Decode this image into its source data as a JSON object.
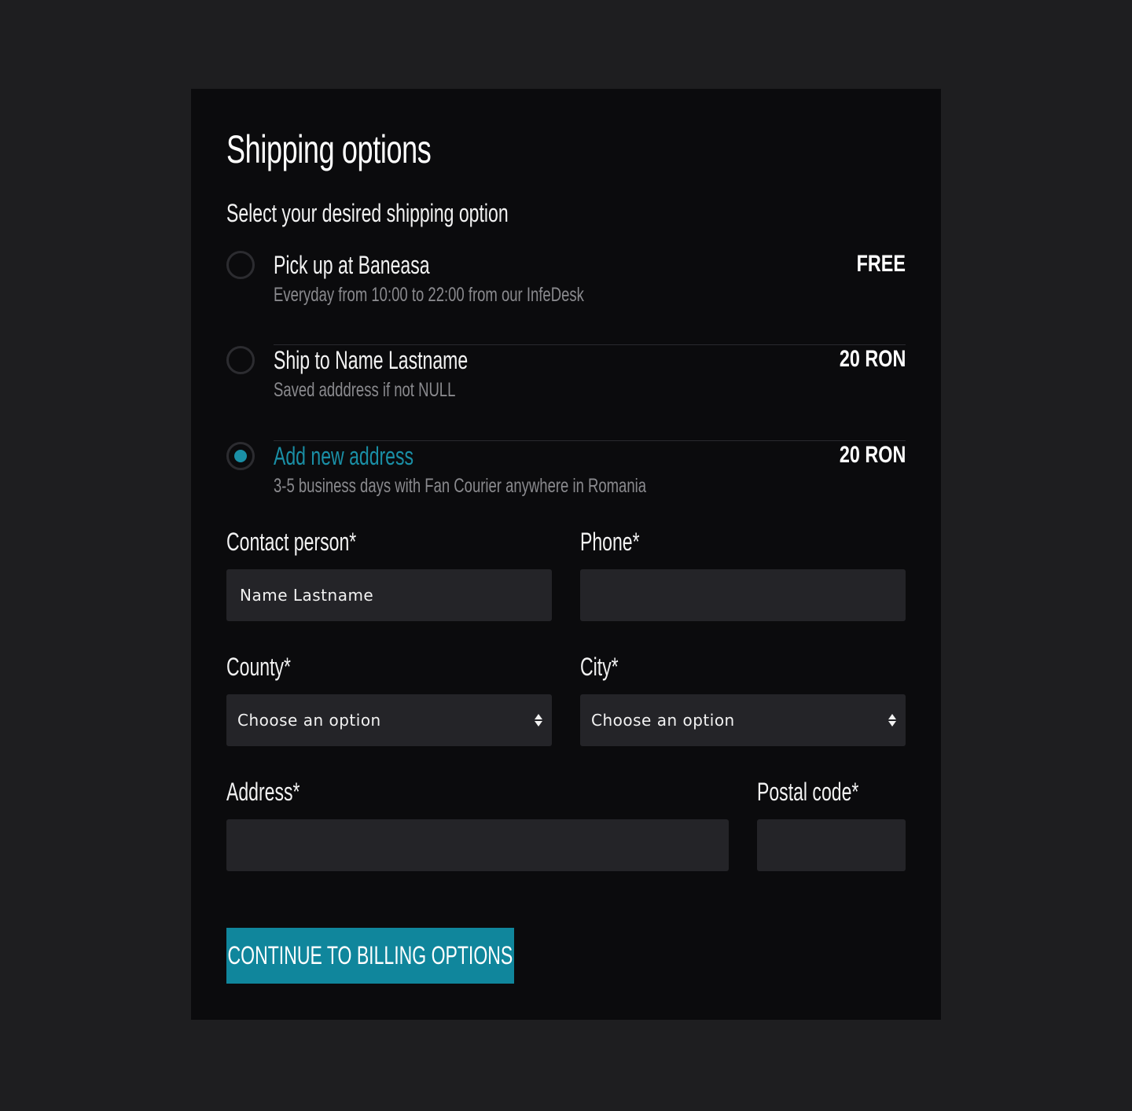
{
  "title": "Shipping options",
  "subtitle": "Select your desired shipping option",
  "options": [
    {
      "label": "Pick up at Baneasa",
      "desc": "Everyday from 10:00 to 22:00 from our InfeDesk",
      "price": "FREE",
      "selected": false
    },
    {
      "label": "Ship to Name Lastname",
      "desc": "Saved adddress if not NULL",
      "price": "20 RON",
      "selected": false
    },
    {
      "label": "Add new address",
      "desc": "3-5 business days with Fan Courier anywhere in Romania",
      "price": "20 RON",
      "selected": true
    }
  ],
  "form": {
    "contact_label": "Contact person*",
    "contact_value": "Name Lastname",
    "phone_label": "Phone*",
    "phone_value": "",
    "county_label": "County*",
    "county_value": "Choose an option",
    "city_label": "City*",
    "city_value": "Choose an option",
    "address_label": "Address*",
    "address_value": "",
    "postal_label": "Postal code*",
    "postal_value": ""
  },
  "continue_label": "CONTINUE TO BILLING OPTIONS",
  "colors": {
    "accent": "#10869c",
    "background": "#1e1e20",
    "card": "#0b0b0d",
    "input": "#242428"
  }
}
